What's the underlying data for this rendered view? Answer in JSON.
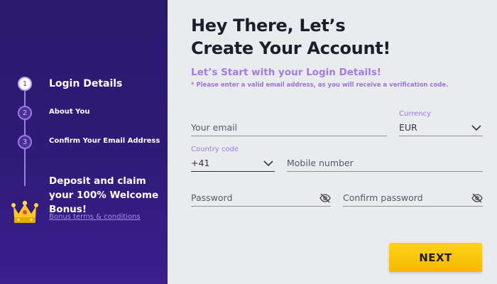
{
  "sidebar": {
    "steps": [
      {
        "number": "1",
        "label": "Login Details"
      },
      {
        "number": "2",
        "label": "About You"
      },
      {
        "number": "3",
        "label": "Confirm Your Email Address"
      }
    ],
    "bonus_text": "Deposit and claim your 100% Welcome Bonus!",
    "bonus_link": "Bonus terms & conditions"
  },
  "main": {
    "title_line1": "Hey There, Let’s",
    "title_line2": "Create Your Account!",
    "subtitle": "Let’s Start with your Login Details!",
    "note": "* Please enter a valid email address, as you will receive a verification code."
  },
  "form": {
    "email_placeholder": "Your email",
    "currency_label": "Currency",
    "currency_value": "EUR",
    "country_code_label": "Country code",
    "country_code_value": "+41",
    "mobile_placeholder": "Mobile number",
    "password_placeholder": "Password",
    "confirm_password_placeholder": "Confirm password"
  },
  "next_label": "NEXT",
  "colors": {
    "sidebar_bg": "#2e1b78",
    "accent_purple": "#a27be2",
    "button_yellow": "#ffd31a"
  }
}
